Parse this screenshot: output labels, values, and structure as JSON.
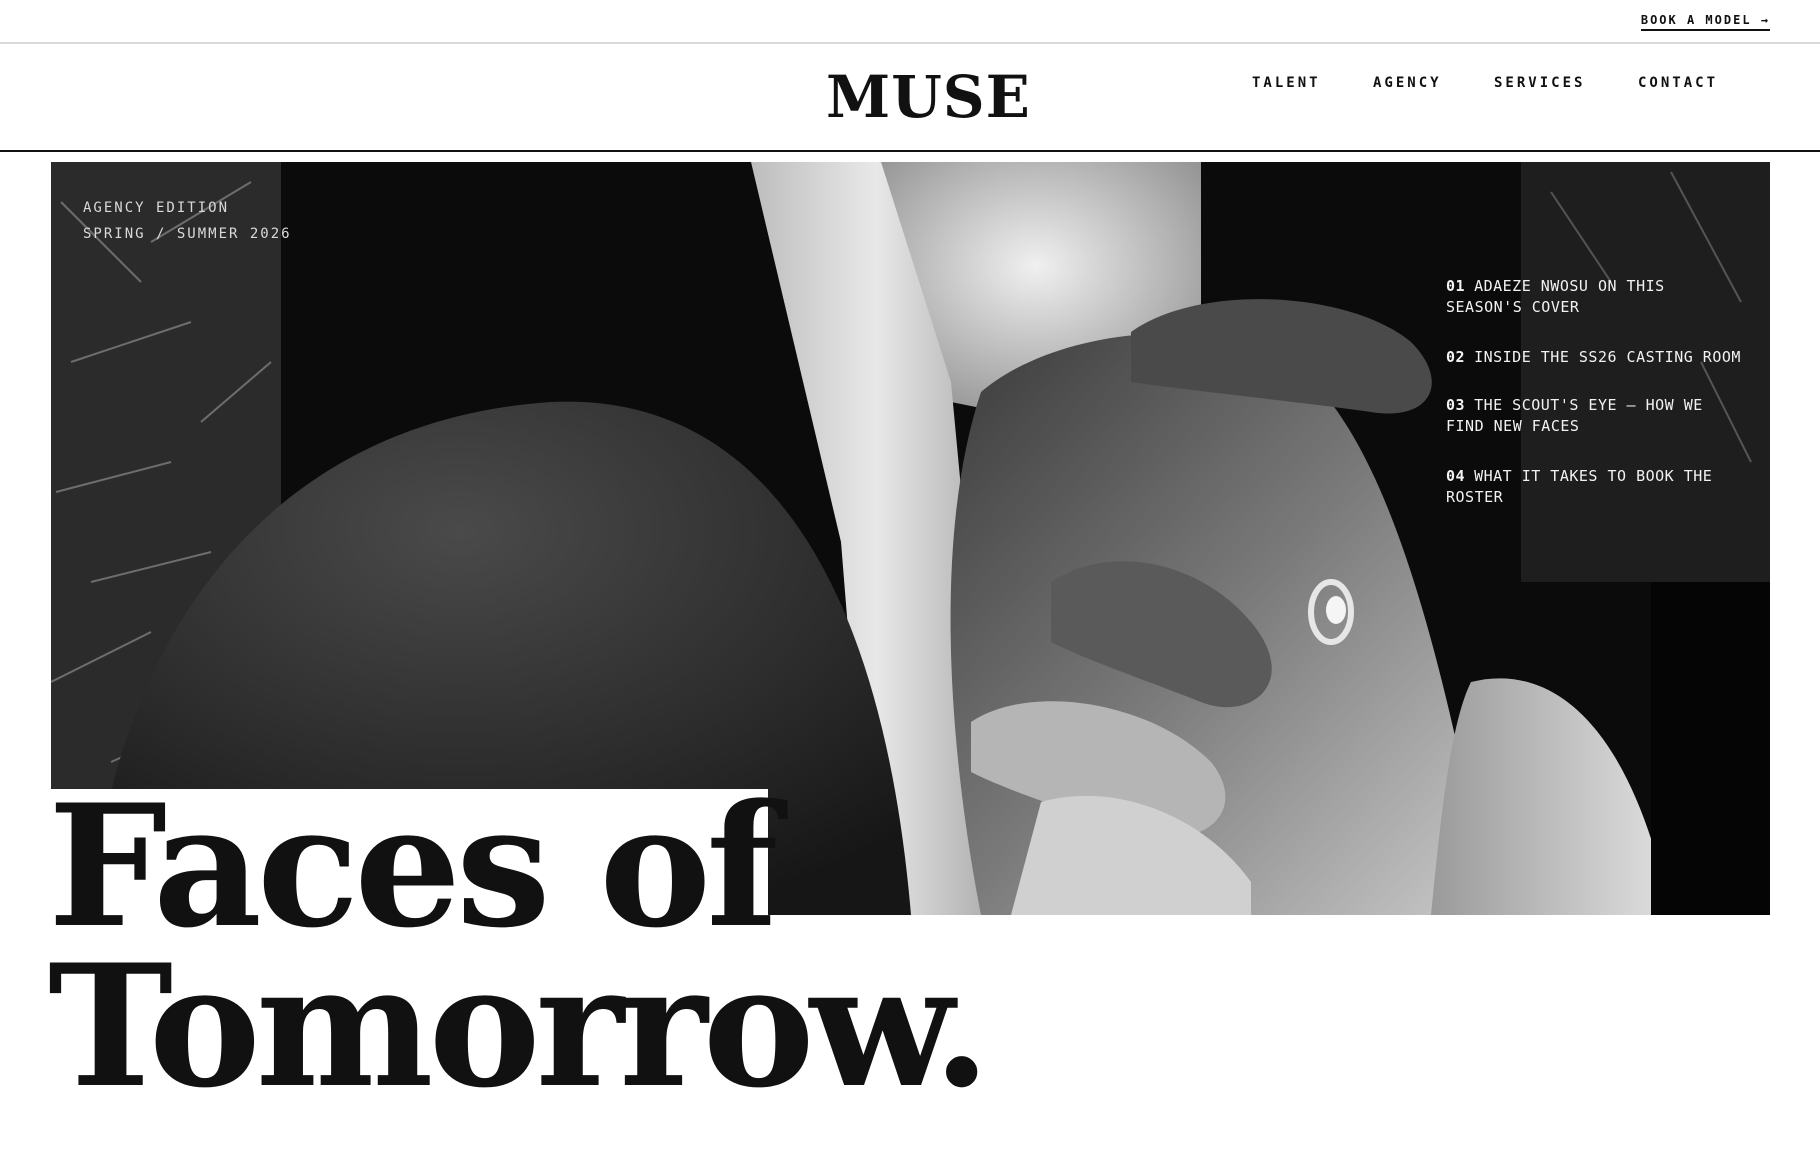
{
  "topbar": {
    "book_label": "BOOK A MODEL →"
  },
  "header": {
    "logo": "MUSE",
    "nav": [
      {
        "label": "TALENT"
      },
      {
        "label": "AGENCY"
      },
      {
        "label": "SERVICES"
      },
      {
        "label": "CONTACT"
      }
    ]
  },
  "hero": {
    "edition_line1": "AGENCY EDITION",
    "edition_line2": "SPRING / SUMMER 2026",
    "toc": [
      {
        "num": "01",
        "title": "ADAEZE NWOSU ON THIS SEASON'S COVER"
      },
      {
        "num": "02",
        "title": "INSIDE THE SS26 CASTING ROOM"
      },
      {
        "num": "03",
        "title": "THE SCOUT'S EYE — HOW WE FIND NEW FACES"
      },
      {
        "num": "04",
        "title": "WHAT IT TAKES TO BOOK THE ROSTER"
      }
    ],
    "headline_line1": "Faces of",
    "headline_line2": "Tomorrow."
  },
  "colors": {
    "ink": "#111111",
    "paper": "#ffffff",
    "photo_dark": "#0a0a0a",
    "photo_light": "#e6e6e6"
  }
}
